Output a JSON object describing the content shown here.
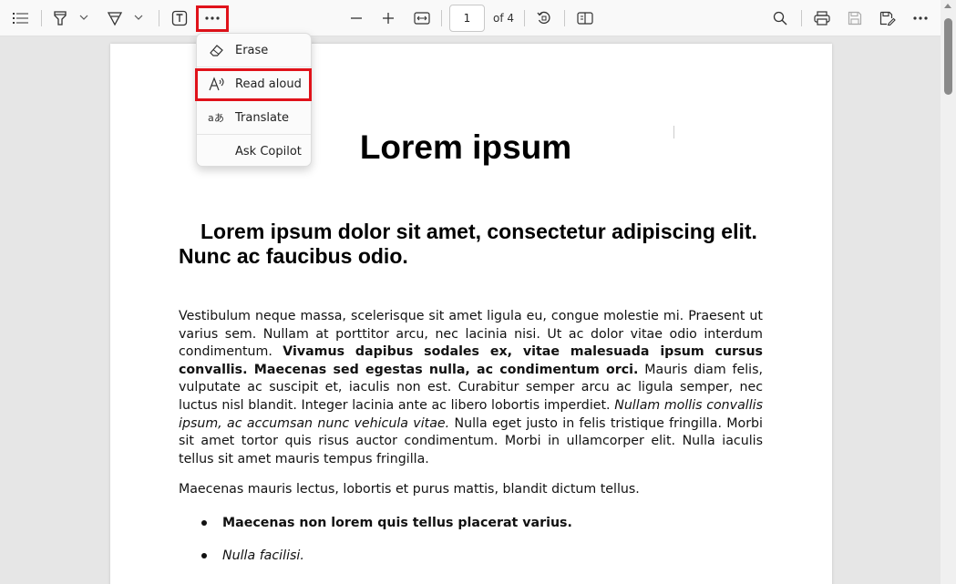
{
  "toolbar": {
    "page_number": "1",
    "page_total": "of 4",
    "icons": [
      "contents-icon",
      "highlight-icon",
      "draw-icon",
      "text-icon",
      "more-icon",
      "zoom-out-icon",
      "zoom-in-icon",
      "fit-width-icon",
      "rotate-icon",
      "two-page-icon",
      "search-icon",
      "print-icon",
      "save-icon",
      "save-as-icon",
      "more-options-icon"
    ]
  },
  "menu": {
    "items": [
      {
        "label": "Erase",
        "icon": "eraser-icon"
      },
      {
        "label": "Read aloud",
        "icon": "read-aloud-icon"
      },
      {
        "label": "Translate",
        "icon": "translate-icon"
      },
      {
        "label": "Ask Copilot",
        "icon": ""
      }
    ]
  },
  "document": {
    "title": "Lorem ipsum",
    "subtitle": "Lorem ipsum dolor sit amet, consectetur adipiscing elit. Nunc ac faucibus odio.",
    "para1": {
      "t1": "Vestibulum neque massa, scelerisque sit amet ligula eu, congue molestie mi. Praesent ut varius sem. Nullam at porttitor arcu, nec lacinia nisi. Ut ac dolor vitae odio interdum condimentum. ",
      "t2": "Vivamus dapibus sodales ex, vitae malesuada ipsum cursus convallis. Maecenas sed egestas nulla, ac condimentum orci.",
      "t3": " Mauris diam felis, vulputate ac suscipit et, iaculis non est. Curabitur semper arcu ac ligula semper, nec luctus nisl blandit. Integer lacinia ante ac libero lobortis imperdiet. ",
      "t4": "Nullam mollis convallis ipsum, ac accumsan nunc vehicula vitae.",
      "t5": " Nulla eget justo in felis tristique fringilla. Morbi sit amet tortor quis risus auctor condimentum. Morbi in ullamcorper elit. Nulla iaculis tellus sit amet mauris tempus fringilla."
    },
    "para2": "Maecenas mauris lectus, lobortis et purus mattis, blandit dictum tellus.",
    "bullets": [
      "Maecenas non lorem quis tellus placerat varius.",
      "Nulla facilisi."
    ]
  },
  "colors": {
    "highlight_box": "#e0121a",
    "toolbar_bg": "#f9f9f9",
    "viewer_bg": "#e6e6e6"
  }
}
